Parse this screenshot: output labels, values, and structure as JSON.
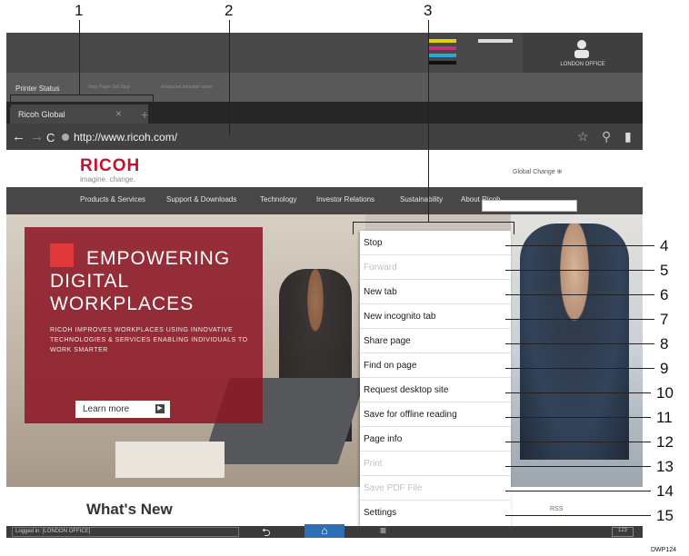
{
  "callouts": [
    "1",
    "2",
    "3",
    "4",
    "5",
    "6",
    "7",
    "8",
    "9",
    "10",
    "11",
    "12",
    "13",
    "14",
    "15"
  ],
  "figure_code": "DWP124",
  "topbar": {
    "user_label": "LONDON OFFICE"
  },
  "status_tabs": {
    "printer_status": "Printer Status",
    "dim_tab_1": "Stop Paper Set Stop",
    "dim_tab_2": "Advanced template name"
  },
  "browser": {
    "tab_title": "Ricoh Global",
    "tab_close": "×",
    "new_tab": "+",
    "back": "←",
    "forward": "→",
    "reload": "C",
    "url": "http://www.ricoh.com/",
    "star": "☆",
    "search": "⚲",
    "bookmark": "▮"
  },
  "site": {
    "logo": "RICOH",
    "tagline": "imagine. change.",
    "global_link": "Global  Change ⊕",
    "nav": [
      "Products & Services",
      "Support & Downloads",
      "Technology",
      "Investor Relations",
      "Sustainability",
      "About Ricoh"
    ],
    "hero": {
      "headline": [
        "EMPOWERING",
        "DIGITAL",
        "WORKPLACES"
      ],
      "subtext": "RICOH IMPROVES WORKPLACES USING INNOVATIVE TECHNOLOGIES & SERVICES ENABLING INDIVIDUALS TO WORK SMARTER",
      "cta": "Learn more",
      "cta_arrow": "▶"
    },
    "whats_new": "What's New",
    "rss": "RSS"
  },
  "menu": {
    "items": [
      {
        "label": "Stop",
        "enabled": true
      },
      {
        "label": "Forward",
        "enabled": false
      },
      {
        "label": "New tab",
        "enabled": true
      },
      {
        "label": "New incognito tab",
        "enabled": true
      },
      {
        "label": "Share page",
        "enabled": true
      },
      {
        "label": "Find on page",
        "enabled": true
      },
      {
        "label": "Request desktop site",
        "enabled": true
      },
      {
        "label": "Save for offline reading",
        "enabled": true
      },
      {
        "label": "Page info",
        "enabled": true
      },
      {
        "label": "Print",
        "enabled": false
      },
      {
        "label": "Save PDF File",
        "enabled": false
      },
      {
        "label": "Settings",
        "enabled": true
      }
    ]
  },
  "bottombar": {
    "login_text": "Logged in: [LONDON OFFICE]",
    "back": "⮌",
    "home": "⌂",
    "menu": "≡",
    "keyboard": "123"
  },
  "colors": {
    "accent_red": "#c8102e",
    "home_blue": "#2d6eb5",
    "hero_panel": "#8c1826"
  }
}
